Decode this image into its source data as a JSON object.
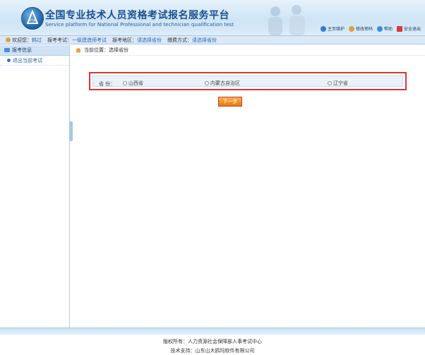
{
  "header": {
    "title_cn": "全国专业技术人员资格考试报名服务平台",
    "title_en": "Service platform for National Professional and technician qualification test",
    "logo_text": "PTA",
    "links": [
      {
        "label": "主页维护",
        "color": "#2f7fd6"
      },
      {
        "label": "修改密码",
        "color": "#e0a03a"
      },
      {
        "label": "帮助",
        "color": "#3c8fd8"
      },
      {
        "label": "安全退出",
        "color": "#d63a3a"
      }
    ]
  },
  "infobar": {
    "welcome_label": "欢迎您：",
    "welcome_value": "韩过",
    "exam_label": "报考考试：",
    "exam_value": "一级建造师考试",
    "region_label": "报考地区：",
    "region_value": "请选择省份",
    "pay_label": "缴费方式：",
    "pay_value": "请选择省份"
  },
  "sidebar": {
    "header": "报考信息",
    "items": [
      {
        "label": "退出当前考试"
      }
    ]
  },
  "breadcrumb": {
    "label": "当前位置：选择省份"
  },
  "province": {
    "label": "省 份：",
    "options": [
      "山西省",
      "内蒙古自治区",
      "辽宁省"
    ]
  },
  "next_button": "下一步",
  "footer": {
    "copyright": "版权所有：人力资源社会保障部人事考试中心",
    "support": "技术支持：山东山大鸥玛软件有限公司"
  }
}
